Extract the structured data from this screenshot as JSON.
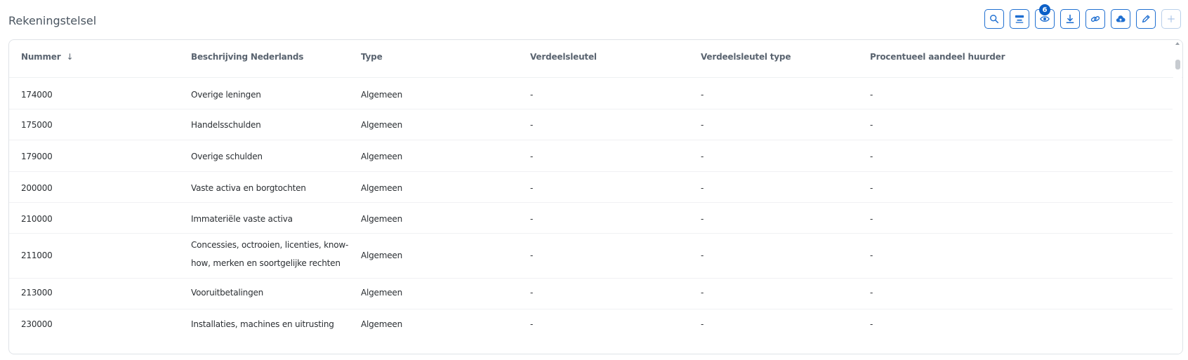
{
  "page": {
    "title": "Rekeningstelsel"
  },
  "toolbar": {
    "buttons": [
      {
        "name": "search",
        "icon": "search-icon"
      },
      {
        "name": "filter",
        "icon": "filter-icon"
      },
      {
        "name": "columns-visibility",
        "icon": "eye-icon",
        "badge": "6"
      },
      {
        "name": "download",
        "icon": "download-icon"
      },
      {
        "name": "link",
        "icon": "link-icon"
      },
      {
        "name": "upload",
        "icon": "cloud-upload-icon"
      },
      {
        "name": "edit",
        "icon": "pencil-icon"
      },
      {
        "name": "add",
        "icon": "plus-icon"
      }
    ],
    "accent_color": "#1f6fd1"
  },
  "table": {
    "columns": [
      {
        "label": "Nummer",
        "sorted": "descending"
      },
      {
        "label": "Beschrijving Nederlands"
      },
      {
        "label": "Type"
      },
      {
        "label": "Verdeelsleutel"
      },
      {
        "label": "Verdeelsleutel type"
      },
      {
        "label": "Procentueel aandeel huurder"
      }
    ],
    "rows": [
      [
        "174000",
        "Overige leningen",
        "Algemeen",
        "-",
        "-",
        "-"
      ],
      [
        "175000",
        "Handelsschulden",
        "Algemeen",
        "-",
        "-",
        "-"
      ],
      [
        "179000",
        "Overige schulden",
        "Algemeen",
        "-",
        "-",
        "-"
      ],
      [
        "200000",
        "Vaste activa en borgtochten",
        "Algemeen",
        "-",
        "-",
        "-"
      ],
      [
        "210000",
        "Immateriële vaste activa",
        "Algemeen",
        "-",
        "-",
        "-"
      ],
      [
        "211000",
        "Concessies, octrooien, licenties, know-how, merken en soortgelijke rechten",
        "Algemeen",
        "-",
        "-",
        "-"
      ],
      [
        "213000",
        "Vooruitbetalingen",
        "Algemeen",
        "-",
        "-",
        "-"
      ],
      [
        "230000",
        "Installaties, machines en uitrusting",
        "Algemeen",
        "-",
        "-",
        "-"
      ]
    ]
  }
}
